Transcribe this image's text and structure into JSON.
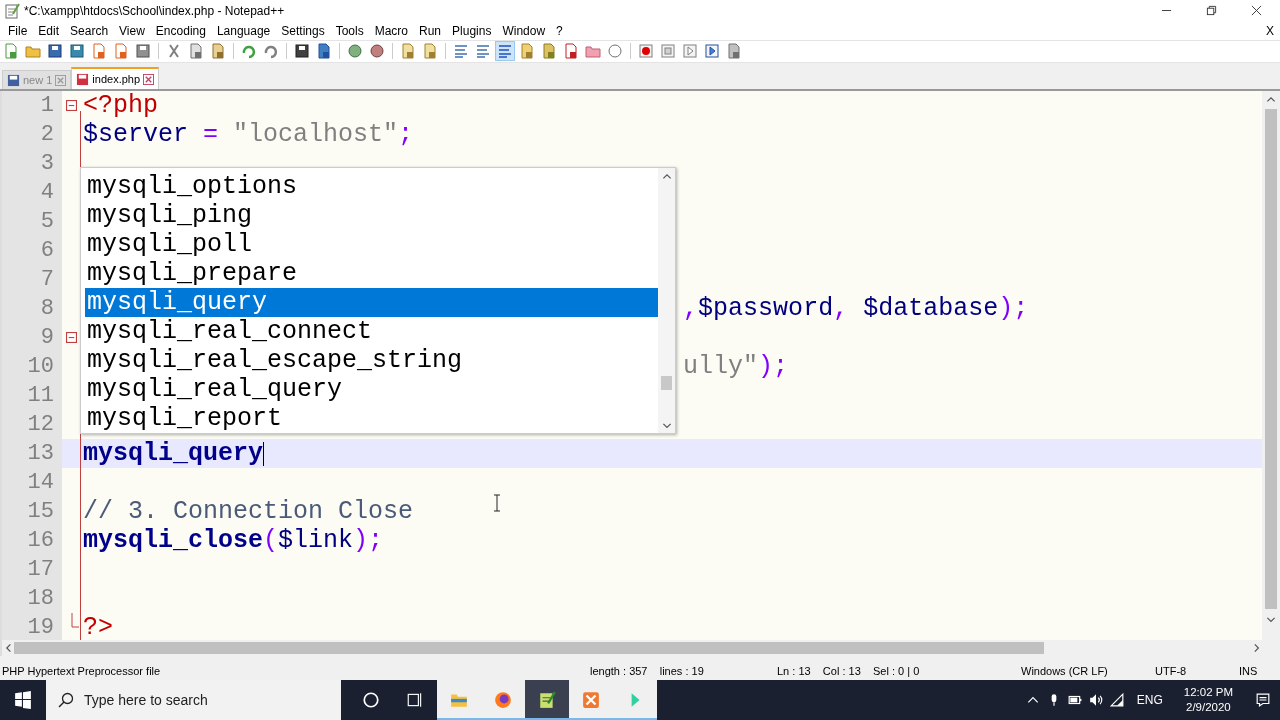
{
  "window": {
    "title": "*C:\\xampp\\htdocs\\School\\index.php - Notepad++"
  },
  "menu": [
    "File",
    "Edit",
    "Search",
    "View",
    "Encoding",
    "Language",
    "Settings",
    "Tools",
    "Macro",
    "Run",
    "Plugins",
    "Window",
    "?"
  ],
  "menu_close": "X",
  "tabs": [
    {
      "label": "new 1",
      "selected": false,
      "modified": false
    },
    {
      "label": "index.php",
      "selected": true,
      "modified": true
    }
  ],
  "editor": {
    "lines": [
      {
        "number": "1",
        "current": false,
        "fold_start": true,
        "fold_end": false,
        "kind": "full",
        "tokens": [
          {
            "t": "<?php",
            "kind": "tag"
          }
        ]
      },
      {
        "number": "2",
        "current": false,
        "fold_start": false,
        "fold_end": false,
        "kind": "full",
        "tokens": [
          {
            "t": "$server",
            "kind": "var"
          },
          {
            "t": " = ",
            "kind": "op"
          },
          {
            "t": "\"localhost\"",
            "kind": "str"
          },
          {
            "t": ";",
            "kind": "op"
          }
        ]
      },
      {
        "number": "3",
        "current": false,
        "fold_start": false,
        "fold_end": false,
        "kind": "full"
      },
      {
        "number": "4",
        "current": false,
        "fold_start": false,
        "fold_end": false,
        "kind": "full"
      },
      {
        "number": "5",
        "current": false,
        "fold_start": false,
        "fold_end": false,
        "kind": "full"
      },
      {
        "number": "6",
        "current": false,
        "fold_start": false,
        "fold_end": false,
        "kind": "full"
      },
      {
        "number": "7",
        "current": false,
        "fold_start": false,
        "fold_end": false,
        "kind": "full"
      },
      {
        "number": "8",
        "current": false,
        "fold_start": false,
        "fold_end": false,
        "kind": "tail",
        "tokens": [
          {
            "t": ",",
            "kind": "op"
          },
          {
            "t": "$password",
            "kind": "var"
          },
          {
            "t": ", ",
            "kind": "op"
          },
          {
            "t": "$database",
            "kind": "var"
          },
          {
            "t": ");",
            "kind": "op"
          }
        ]
      },
      {
        "number": "9",
        "current": false,
        "fold_start": true,
        "fold_end": false,
        "kind": "full"
      },
      {
        "number": "10",
        "current": false,
        "fold_start": false,
        "fold_end": false,
        "kind": "tail",
        "tokens": [
          {
            "t": "ully\"",
            "kind": "str"
          },
          {
            "t": ");",
            "kind": "op"
          }
        ]
      },
      {
        "number": "11",
        "current": false,
        "fold_start": false,
        "fold_end": false,
        "kind": "full"
      },
      {
        "number": "12",
        "current": false,
        "fold_start": false,
        "fold_end": false,
        "kind": "full"
      },
      {
        "number": "13",
        "current": true,
        "fold_start": false,
        "fold_end": false,
        "kind": "full",
        "tokens": [
          {
            "t": "mysqli_query",
            "kind": "func"
          }
        ]
      },
      {
        "number": "14",
        "current": false,
        "fold_start": false,
        "fold_end": false,
        "kind": "full"
      },
      {
        "number": "15",
        "current": false,
        "fold_start": false,
        "fold_end": false,
        "kind": "full",
        "tokens": [
          {
            "t": "// 3. Connection Close",
            "kind": "comment"
          }
        ]
      },
      {
        "number": "16",
        "current": false,
        "fold_start": false,
        "fold_end": false,
        "kind": "full",
        "tokens": [
          {
            "t": "mysqli_close",
            "kind": "func"
          },
          {
            "t": "(",
            "kind": "op"
          },
          {
            "t": "$link",
            "kind": "var"
          },
          {
            "t": ");",
            "kind": "op"
          }
        ]
      },
      {
        "number": "17",
        "current": false,
        "fold_start": false,
        "fold_end": false,
        "kind": "full"
      },
      {
        "number": "18",
        "current": false,
        "fold_start": false,
        "fold_end": false,
        "kind": "full"
      },
      {
        "number": "19",
        "current": false,
        "fold_start": false,
        "fold_end": true,
        "kind": "full",
        "tokens": [
          {
            "t": "?>",
            "kind": "tag"
          }
        ]
      }
    ]
  },
  "autocomplete": {
    "items": [
      {
        "label": "mysqli_options",
        "selected": false
      },
      {
        "label": "mysqli_ping",
        "selected": false
      },
      {
        "label": "mysqli_poll",
        "selected": false
      },
      {
        "label": "mysqli_prepare",
        "selected": false
      },
      {
        "label": "mysqli_query",
        "selected": true
      },
      {
        "label": "mysqli_real_connect",
        "selected": false
      },
      {
        "label": "mysqli_real_escape_string",
        "selected": false
      },
      {
        "label": "mysqli_real_query",
        "selected": false
      },
      {
        "label": "mysqli_report",
        "selected": false
      }
    ]
  },
  "status_bar": {
    "file_type": "PHP Hypertext Preprocessor file",
    "length": "length : 357    lines : 19",
    "position": "Ln : 13    Col : 13    Sel : 0 | 0",
    "eol": "Windows (CR LF)",
    "encoding": "UTF-8",
    "mode": "INS"
  },
  "taskbar": {
    "search_placeholder": "Type here to search",
    "language": "ENG",
    "time": "12:02 PM",
    "date": "2/9/2020"
  }
}
